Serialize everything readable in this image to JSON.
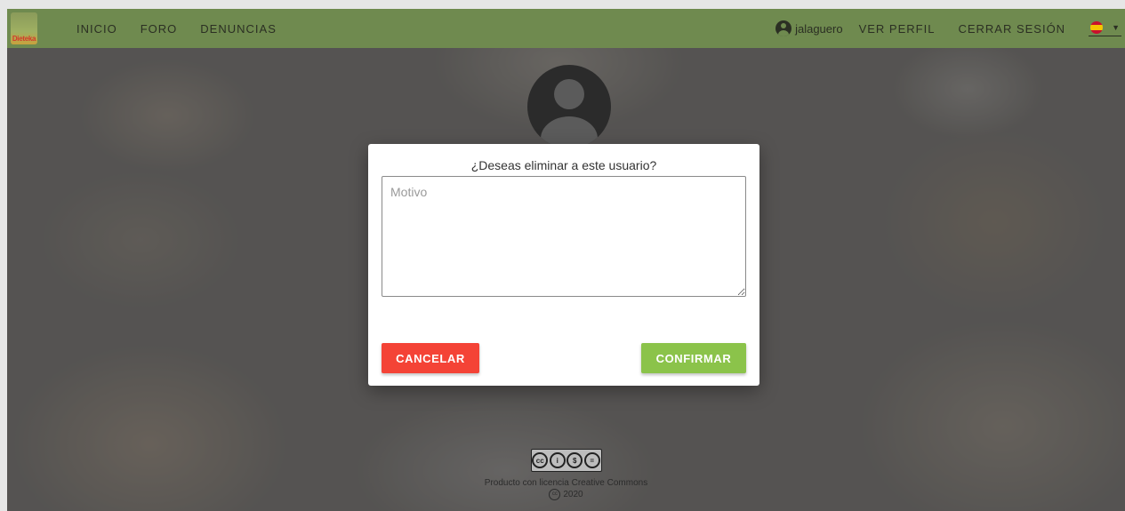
{
  "navbar": {
    "brand_text": "Dieteka",
    "links": [
      "INICIO",
      "FORO",
      "DENUNCIAS"
    ],
    "username": "jalaguero",
    "profile_label": "VER PERFIL",
    "logout_label": "CERRAR SESIÓN",
    "language_icon": "spain-flag-icon"
  },
  "modal": {
    "title": "¿Deseas eliminar a este usuario?",
    "reason_placeholder": "Motivo",
    "reason_value": "",
    "cancel_label": "CANCELAR",
    "confirm_label": "CONFIRMAR"
  },
  "footer": {
    "license_badge": "BY NC ND",
    "license_text": "Producto con licencia Creative Commons",
    "copyright_symbol": "cc",
    "year": "2020"
  },
  "colors": {
    "navbar": "#6f8a4f",
    "cancel": "#f44336",
    "confirm": "#8bc34a"
  }
}
